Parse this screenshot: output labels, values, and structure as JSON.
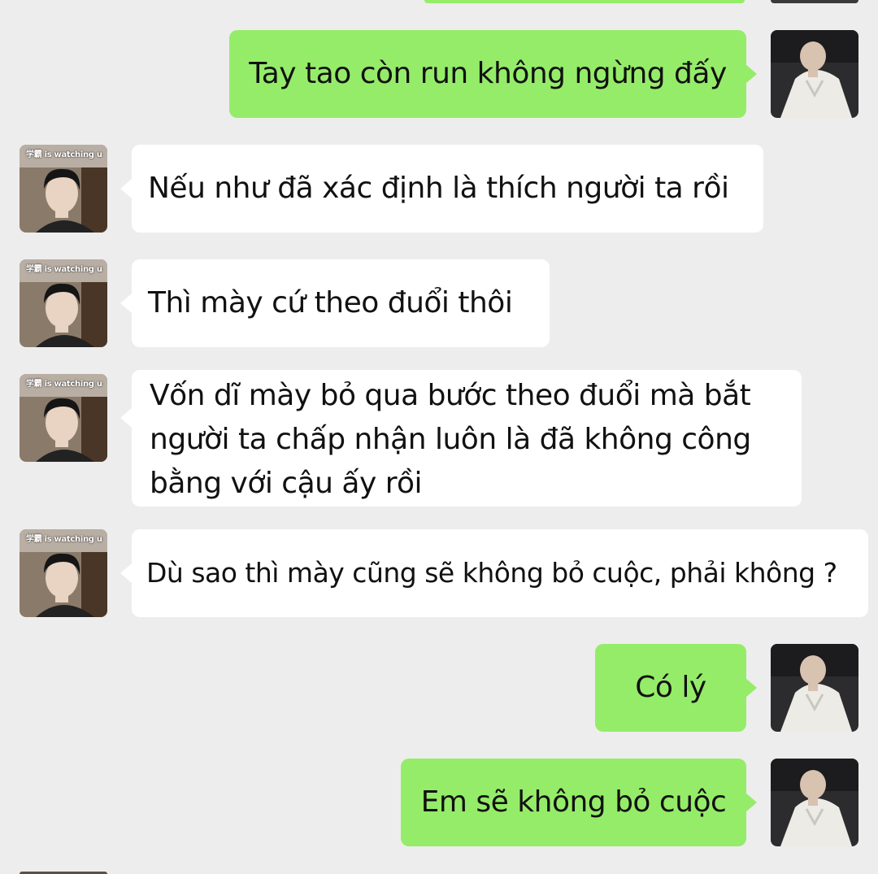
{
  "contacts": {
    "friend": {
      "avatar_icon": "friend-avatar-icon",
      "avatar_caption": "学霸 is watching u"
    },
    "me": {
      "avatar_icon": "my-avatar-icon"
    }
  },
  "messages": [
    {
      "sender": "me",
      "text": "Tay tao còn run không ngừng đấy"
    },
    {
      "sender": "friend",
      "text": "Nếu như đã xác định là thích người ta rồi"
    },
    {
      "sender": "friend",
      "text": "Thì mày cứ theo đuổi thôi"
    },
    {
      "sender": "friend",
      "text": "Vốn dĩ mày bỏ qua bước theo đuổi mà bắt người ta chấp nhận luôn là đã không công bằng với cậu ấy rồi"
    },
    {
      "sender": "friend",
      "text": "Dù sao thì mày cũng sẽ không bỏ cuộc, phải không ?"
    },
    {
      "sender": "me",
      "text": "Có lý"
    },
    {
      "sender": "me",
      "text": "Em sẽ không bỏ cuộc"
    }
  ],
  "colors": {
    "background": "#ededed",
    "outgoing_bubble": "#95ec69",
    "incoming_bubble": "#ffffff",
    "text": "#111111"
  }
}
